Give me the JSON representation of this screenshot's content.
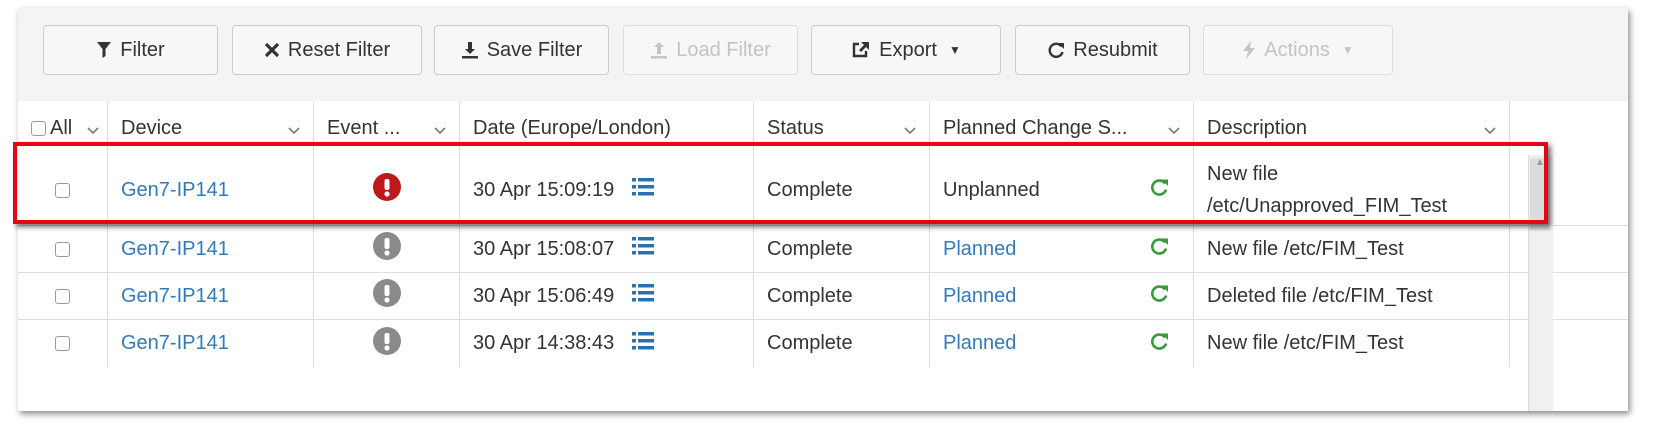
{
  "toolbar": {
    "filter": "Filter",
    "reset_filter": "Reset Filter",
    "save_filter": "Save Filter",
    "load_filter": "Load Filter",
    "export": "Export",
    "resubmit": "Resubmit",
    "actions": "Actions"
  },
  "columns": {
    "all": "All",
    "device": "Device",
    "event": "Event ...",
    "date": "Date (Europe/London)",
    "status": "Status",
    "planned": "Planned Change S...",
    "description": "Description"
  },
  "rows": [
    {
      "device": "Gen7-IP141",
      "event_icon": "alert-circle-icon",
      "event_color": "#c0171d",
      "date": "30 Apr 15:09:19",
      "status": "Complete",
      "planned": "Unplanned",
      "description_line1": "New file",
      "description_line2": "/etc/Unapproved_FIM_Test"
    },
    {
      "device": "Gen7-IP141",
      "event_icon": "alert-circle-icon",
      "event_color": "#8a8a8a",
      "date": "30 Apr 15:08:07",
      "status": "Complete",
      "planned": "Planned",
      "description": "New file /etc/FIM_Test"
    },
    {
      "device": "Gen7-IP141",
      "event_icon": "alert-circle-icon",
      "event_color": "#8a8a8a",
      "date": "30 Apr 15:06:49",
      "status": "Complete",
      "planned": "Planned",
      "description": "Deleted file /etc/FIM_Test"
    },
    {
      "device": "Gen7-IP141",
      "event_icon": "alert-circle-icon",
      "event_color": "#8a8a8a",
      "date": "30 Apr 14:38:43",
      "status": "Complete",
      "planned": "Planned",
      "description": "New file /etc/FIM_Test"
    }
  ],
  "colors": {
    "link": "#337ab7",
    "refresh": "#3a9a3a",
    "list_icon": "#2a6fb0",
    "highlight": "#e30613",
    "critical": "#c0171d"
  }
}
